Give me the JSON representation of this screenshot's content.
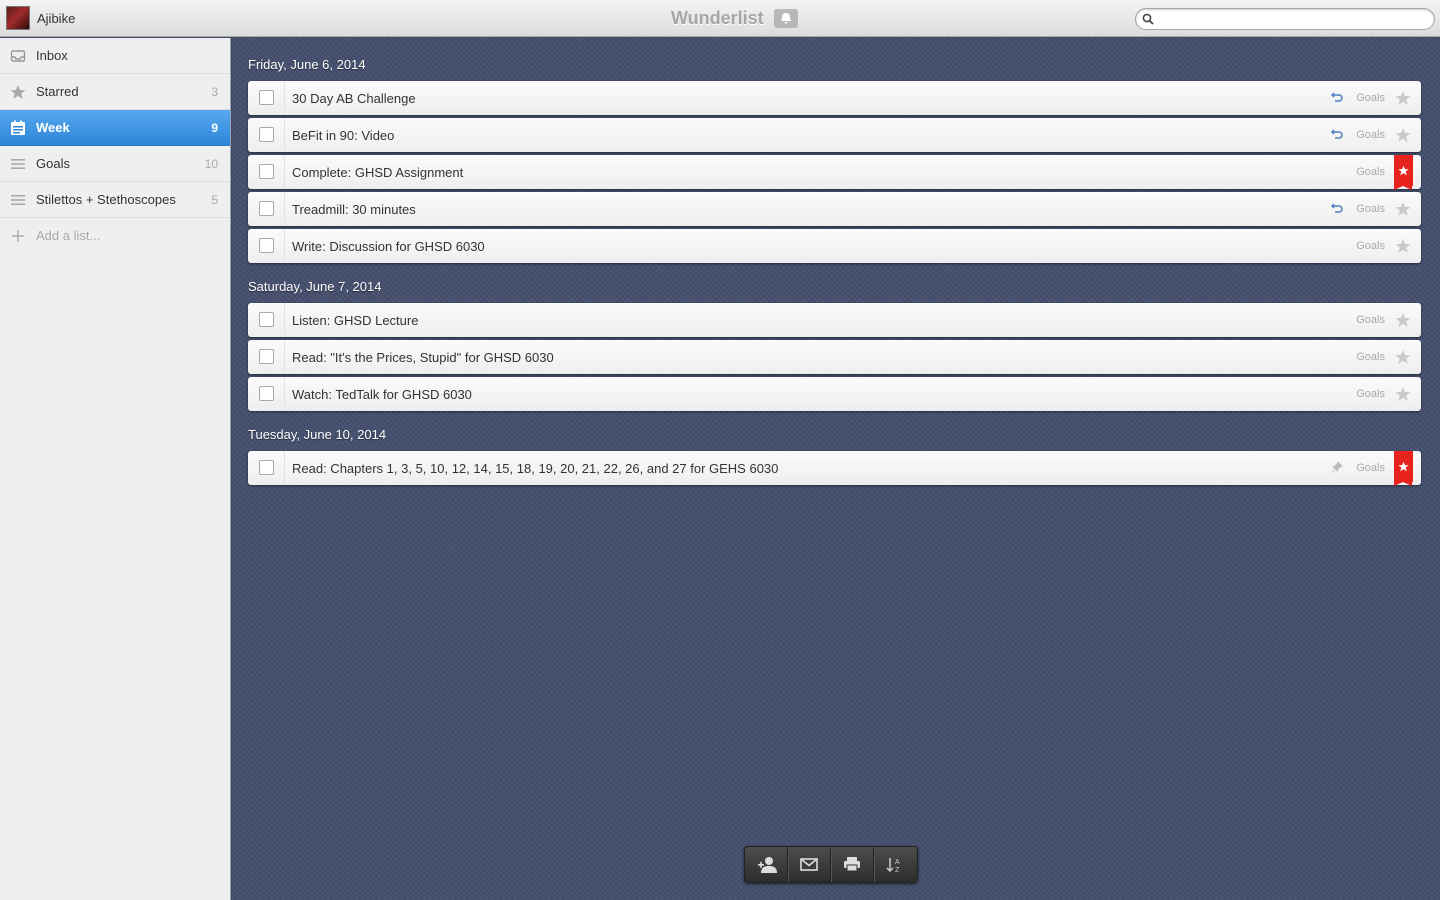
{
  "titlebar": {
    "username": "Ajibike",
    "app_title": "Wunderlist",
    "search_placeholder": ""
  },
  "sidebar": {
    "items": [
      {
        "label": "Inbox",
        "count": "",
        "icon": "inbox-icon"
      },
      {
        "label": "Starred",
        "count": "3",
        "icon": "star-icon"
      },
      {
        "label": "Week",
        "count": "9",
        "icon": "calendar-icon",
        "active": true
      },
      {
        "label": "Goals",
        "count": "10",
        "icon": "list-icon"
      },
      {
        "label": "Stilettos + Stethoscopes",
        "count": "5",
        "icon": "list-icon"
      }
    ],
    "add_list_label": "Add a list..."
  },
  "groups": [
    {
      "date": "Friday, June 6, 2014",
      "tasks": [
        {
          "title": "30 Day AB Challenge",
          "list": "Goals",
          "recurring": true,
          "starred": false
        },
        {
          "title": "BeFit in 90: Video",
          "list": "Goals",
          "recurring": true,
          "starred": false
        },
        {
          "title": "Complete: GHSD Assignment",
          "list": "Goals",
          "recurring": false,
          "starred": true
        },
        {
          "title": "Treadmill: 30 minutes",
          "list": "Goals",
          "recurring": true,
          "starred": false
        },
        {
          "title": "Write: Discussion for GHSD 6030",
          "list": "Goals",
          "recurring": false,
          "starred": false
        }
      ]
    },
    {
      "date": "Saturday, June 7, 2014",
      "tasks": [
        {
          "title": "Listen: GHSD Lecture",
          "list": "Goals",
          "recurring": false,
          "starred": false
        },
        {
          "title": "Read: \"It's the Prices, Stupid\" for GHSD 6030",
          "list": "Goals",
          "recurring": false,
          "starred": false
        },
        {
          "title": "Watch: TedTalk for GHSD 6030",
          "list": "Goals",
          "recurring": false,
          "starred": false
        }
      ]
    },
    {
      "date": "Tuesday, June 10, 2014",
      "tasks": [
        {
          "title": "Read: Chapters 1, 3, 5, 10, 12, 14, 15, 18, 19, 20, 21, 22, 26, and 27 for GEHS 6030",
          "list": "Goals",
          "recurring": false,
          "pinned": true,
          "starred": true
        }
      ]
    }
  ],
  "toolbar": {
    "buttons": [
      "share-user-icon",
      "mail-icon",
      "print-icon",
      "sort-icon"
    ]
  },
  "colors": {
    "accent": "#2d86d8",
    "star_ribbon": "#e8221c",
    "background": "#45506f"
  }
}
